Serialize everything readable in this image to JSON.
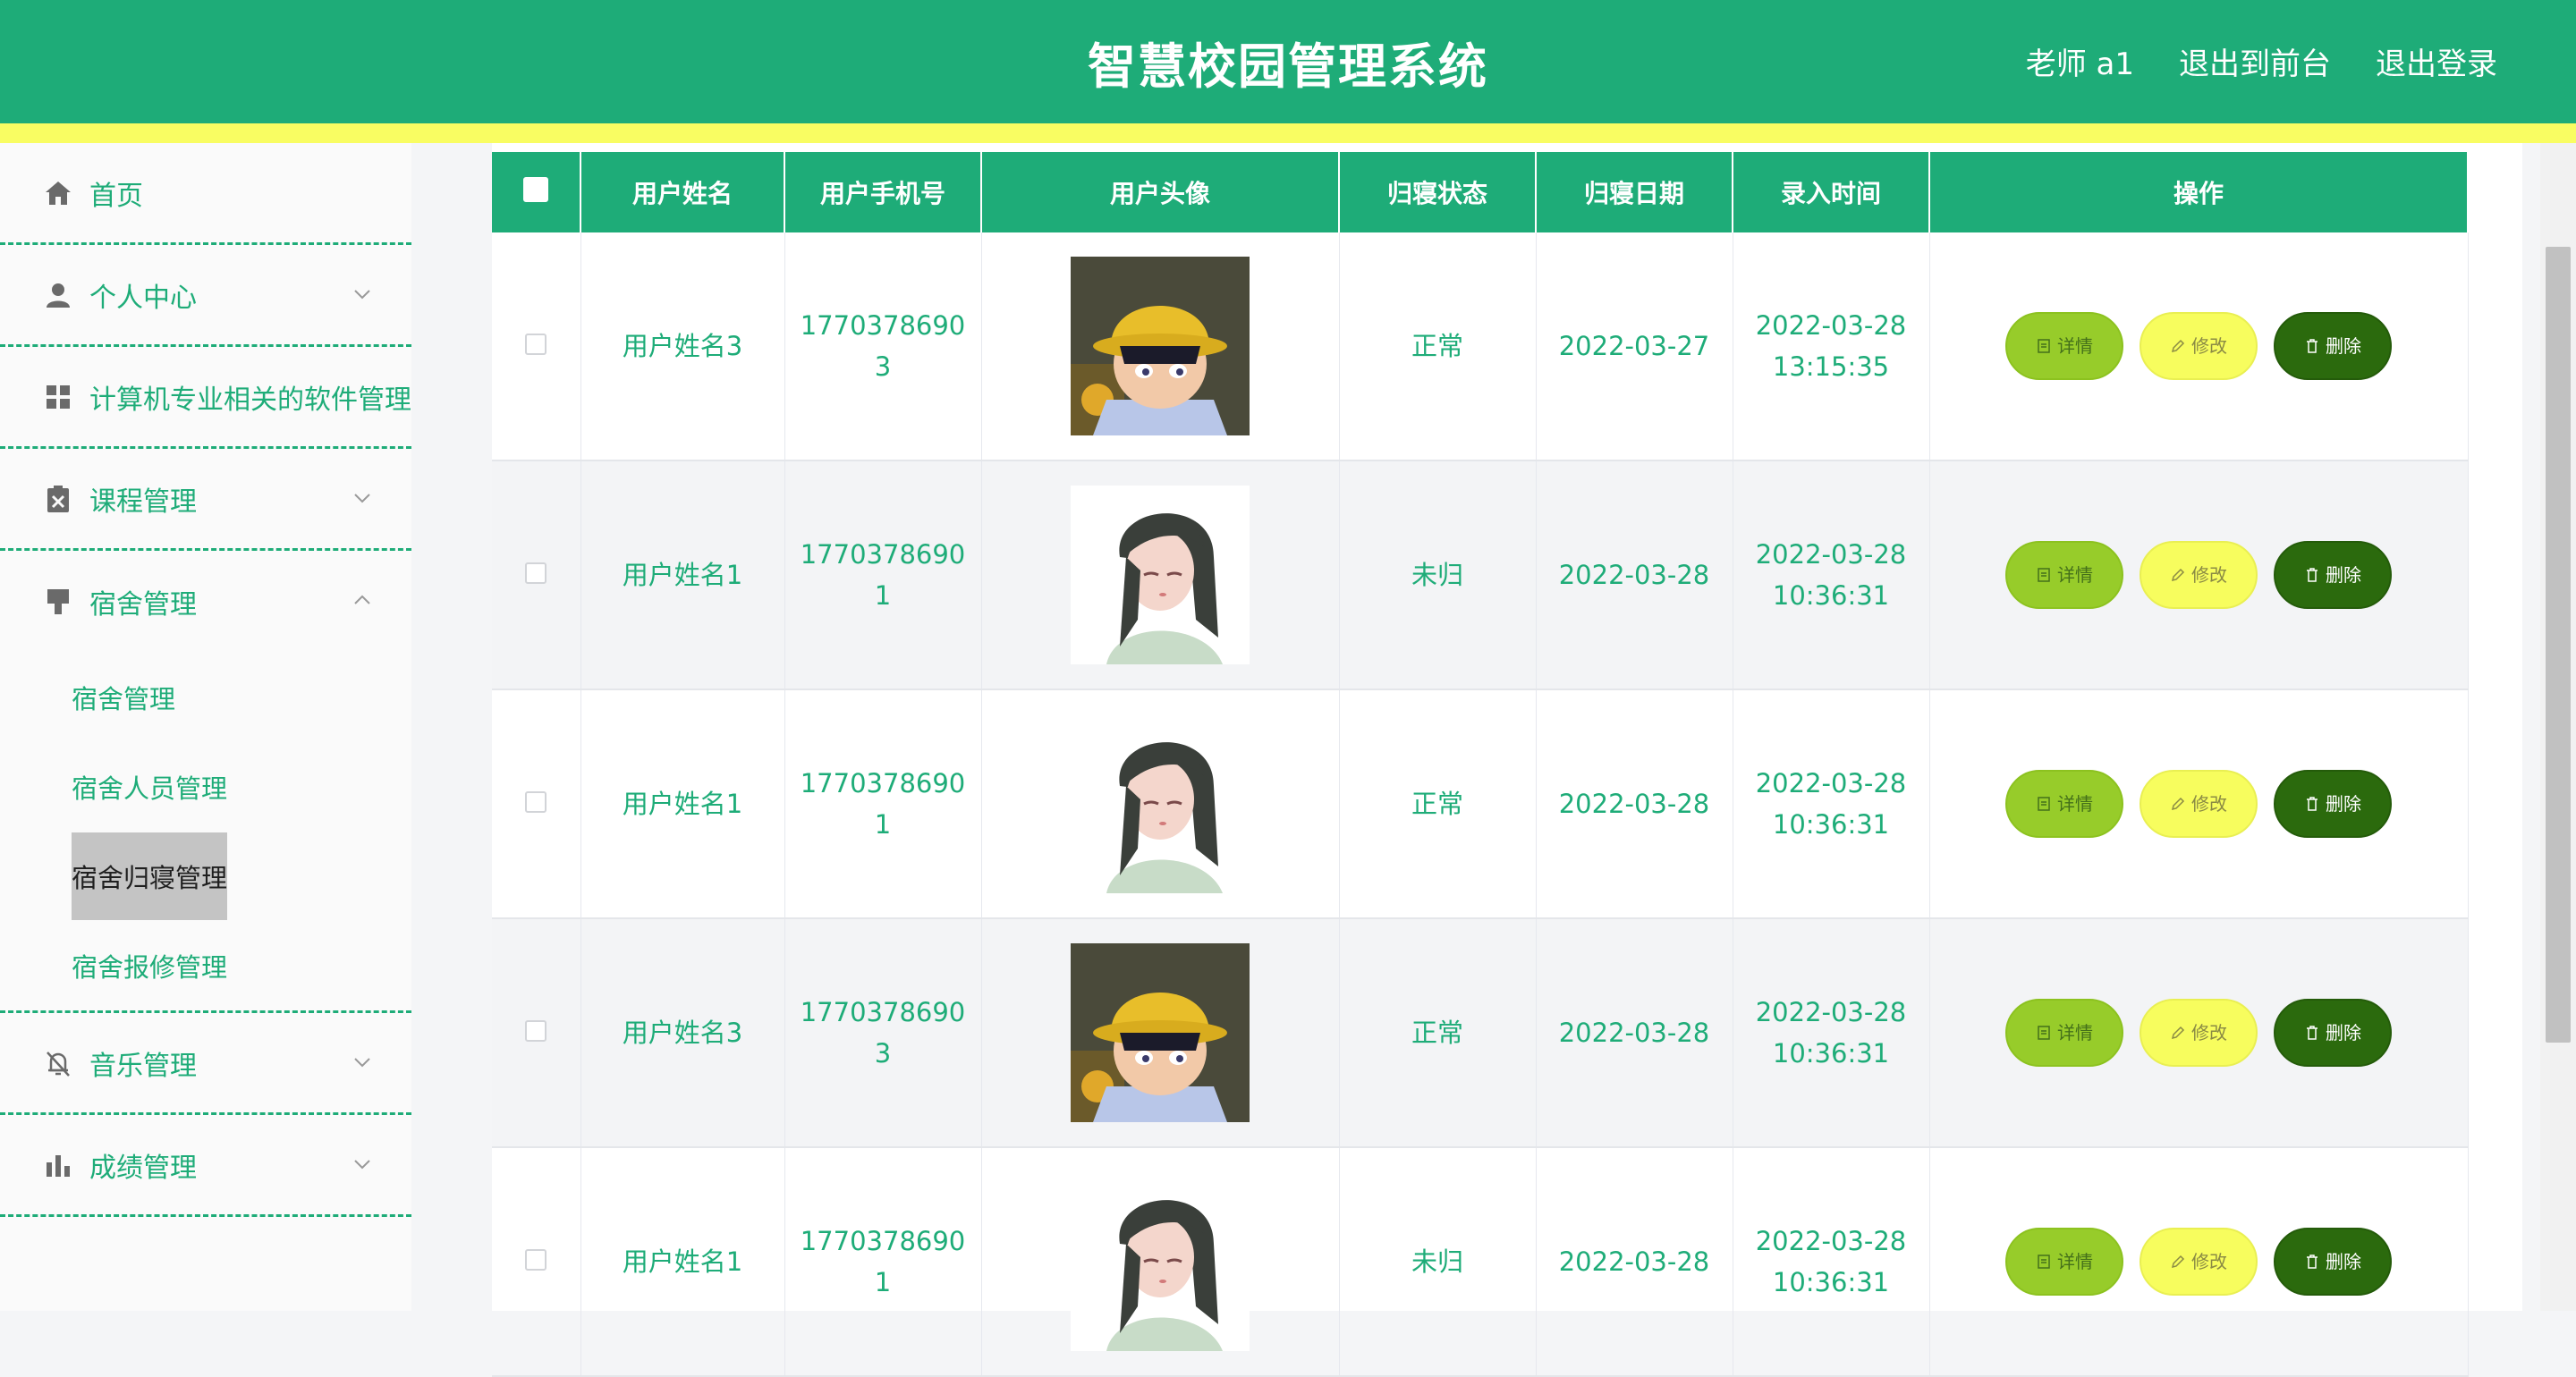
{
  "header": {
    "title": "智慧校园管理系统",
    "user": "老师 a1",
    "to_front": "退出到前台",
    "logout": "退出登录"
  },
  "sidebar": {
    "items": [
      {
        "label": "首页",
        "icon": "home-icon"
      },
      {
        "label": "个人中心",
        "icon": "user-icon",
        "arrow": "down"
      },
      {
        "label": "计算机专业相关的软件管理",
        "icon": "grid-icon"
      },
      {
        "label": "课程管理",
        "icon": "clipboard-icon",
        "arrow": "down"
      },
      {
        "label": "宿舍管理",
        "icon": "dorm-icon",
        "arrow": "up"
      }
    ],
    "submenu": [
      "宿舍管理",
      "宿舍人员管理",
      "宿舍归寝管理",
      "宿舍报修管理"
    ],
    "submenu_active": "宿舍归寝管理",
    "items_after": [
      {
        "label": "音乐管理",
        "icon": "bell-off-icon",
        "arrow": "down"
      },
      {
        "label": "成绩管理",
        "icon": "bar-chart-icon",
        "arrow": "down"
      }
    ]
  },
  "table": {
    "headers": [
      "用户姓名",
      "用户手机号",
      "用户头像",
      "归寝状态",
      "归寝日期",
      "录入时间",
      "操作"
    ],
    "rows": [
      {
        "name": "用户姓名3",
        "phone1": "1770378690",
        "phone2": "3",
        "avatar": "avatar-boy-hat",
        "status": "正常",
        "date": "2022-03-27",
        "time1": "2022-03-28",
        "time2": "13:15:35"
      },
      {
        "name": "用户姓名1",
        "phone1": "1770378690",
        "phone2": "1",
        "avatar": "avatar-girl",
        "status": "未归",
        "date": "2022-03-28",
        "time1": "2022-03-28",
        "time2": "10:36:31"
      },
      {
        "name": "用户姓名1",
        "phone1": "1770378690",
        "phone2": "1",
        "avatar": "avatar-girl",
        "status": "正常",
        "date": "2022-03-28",
        "time1": "2022-03-28",
        "time2": "10:36:31"
      },
      {
        "name": "用户姓名3",
        "phone1": "1770378690",
        "phone2": "3",
        "avatar": "avatar-boy-hat",
        "status": "正常",
        "date": "2022-03-28",
        "time1": "2022-03-28",
        "time2": "10:36:31"
      },
      {
        "name": "用户姓名1",
        "phone1": "1770378690",
        "phone2": "1",
        "avatar": "avatar-girl",
        "status": "未归",
        "date": "2022-03-28",
        "time1": "2022-03-28",
        "time2": "10:36:31"
      }
    ],
    "buttons": {
      "detail": "详情",
      "edit": "修改",
      "delete": "删除"
    }
  },
  "colors": {
    "primary": "#1eac78",
    "accent_yellow": "#f9fd62",
    "detail": "#97cc2a",
    "edit": "#f7fd5e",
    "delete": "#2b6a0d"
  }
}
